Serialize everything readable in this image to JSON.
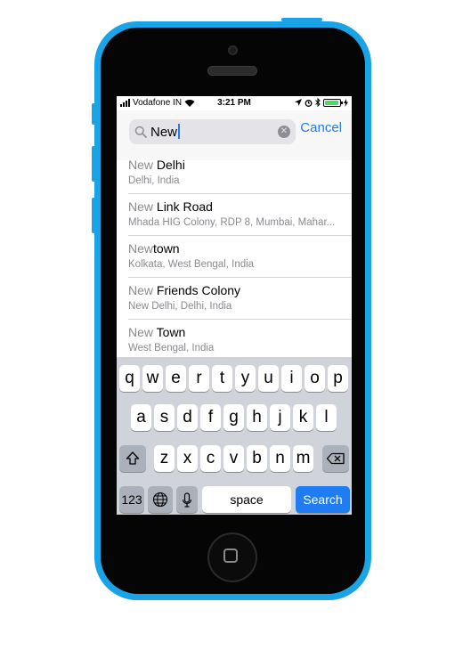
{
  "status_bar": {
    "carrier": "Vodafone IN",
    "time": "3:21 PM",
    "battery_level": 0.95
  },
  "search": {
    "query": "New",
    "cancel_label": "Cancel"
  },
  "results": [
    {
      "match": "New",
      "rest": " Delhi",
      "subtitle": "Delhi, India"
    },
    {
      "match": "New",
      "rest": " Link Road",
      "subtitle": "Mhada HIG Colony, RDP 8, Mumbai, Mahar..."
    },
    {
      "match": "New",
      "rest": "town",
      "subtitle": "Kolkata, West Bengal, India"
    },
    {
      "match": "New",
      "rest": " Friends Colony",
      "subtitle": "New Delhi, Delhi, India"
    },
    {
      "match": "New",
      "rest": " Town",
      "subtitle": "West Bengal, India"
    }
  ],
  "keyboard": {
    "row1": [
      "q",
      "w",
      "e",
      "r",
      "t",
      "y",
      "u",
      "i",
      "o",
      "p"
    ],
    "row2": [
      "a",
      "s",
      "d",
      "f",
      "g",
      "h",
      "j",
      "k",
      "l"
    ],
    "row3": [
      "z",
      "x",
      "c",
      "v",
      "b",
      "n",
      "m"
    ],
    "numbers_label": "123",
    "space_label": "space",
    "search_label": "Search"
  },
  "colors": {
    "phone_body": "#1aa3e6",
    "accent": "#1f7cf2",
    "battery": "#4cd964"
  }
}
